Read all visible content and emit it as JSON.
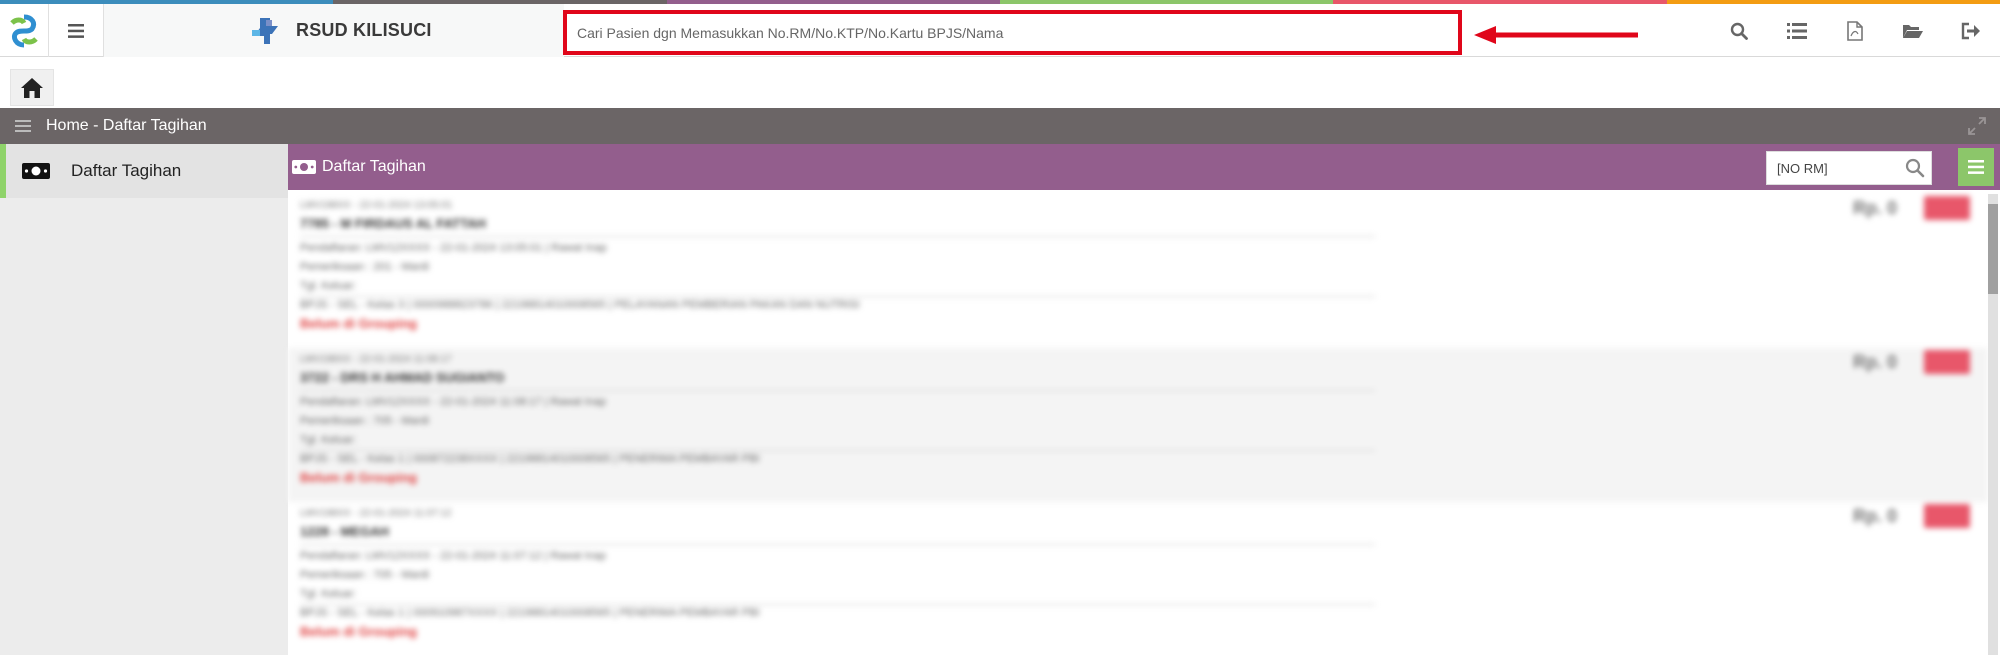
{
  "app": {
    "name": "RSUD KILISUCI"
  },
  "colors": {
    "stripe": [
      "#3c8dbc",
      "#6b6566",
      "#935e8d",
      "#8cc66a",
      "#e8576a",
      "#f39c12"
    ],
    "search_highlight": "#e0061a",
    "panel_header": "#935e8d",
    "breadcrumb_bar": "#6b6566",
    "active_sidebar": "#8fd36a",
    "badge": "#e8576a"
  },
  "search": {
    "placeholder": "Cari Pasien dgn Memasukkan No.RM/No.KTP/No.Kartu BPJS/Nama"
  },
  "toolbar_icons": [
    "search-icon",
    "list-icon",
    "pdf-file-icon",
    "folder-open-icon",
    "sign-out-icon"
  ],
  "breadcrumb": "Home - Daftar Tagihan",
  "sidebar": {
    "items": [
      {
        "label": "Daftar Tagihan",
        "icon": "money-icon"
      }
    ]
  },
  "panel": {
    "title": "Daftar Tagihan",
    "rm_placeholder": "[NO RM]"
  },
  "rows": [
    {
      "lines": [
        "LMV198XX - 22-01-2024 13:05:01",
        "7785 - M FIRDAUS AL FATTAH",
        "Pendaftaran: LMV12XXXX - 22-01-2024 13:05:01 | Rawat Inap",
        "Pemeriksaan : 201 - Mardi",
        "Tgl. Keluar:",
        "BPJS - SEL - Kelas 3 | 0000988823786 | 22198814010008565 | PELAYANAN PEMBERIAN PAKAN DAN NUTRISI",
        "Belum di Grouping"
      ],
      "amount": "Rp. 0"
    },
    {
      "lines": [
        "LMV198XX - 22-01-2024 11:08:17",
        "3722 - DRS H AHMAD SUGIANTO",
        "Pendaftaran: LMV12XXXX - 22-01-2024 11:08:17 | Rawat Inap",
        "Pemeriksaan : 705 - Mardi",
        "Tgl. Keluar:",
        "BPJS - SEL - Kelas 1 | 000872238XXXX | 22198814010008565 | PENERIMA PEMBAYAR PBI",
        "Belum di Grouping"
      ],
      "amount": "Rp. 0"
    },
    {
      "lines": [
        "LMV198XX - 22-01-2024 11:07:12",
        "1228 - MEGAH",
        "Pendaftaran: LMV12XXXX - 22-01-2024 11:07:12 | Rawat Inap",
        "Pemeriksaan : 705 - Mardi",
        "Tgl. Keluar:",
        "BPJS - SEL - Kelas 1 | 000910987XXXX | 22198814010008565 | PENERIMA PEMBAYAR PBI",
        "Belum di Grouping"
      ],
      "amount": "Rp. 0"
    }
  ]
}
